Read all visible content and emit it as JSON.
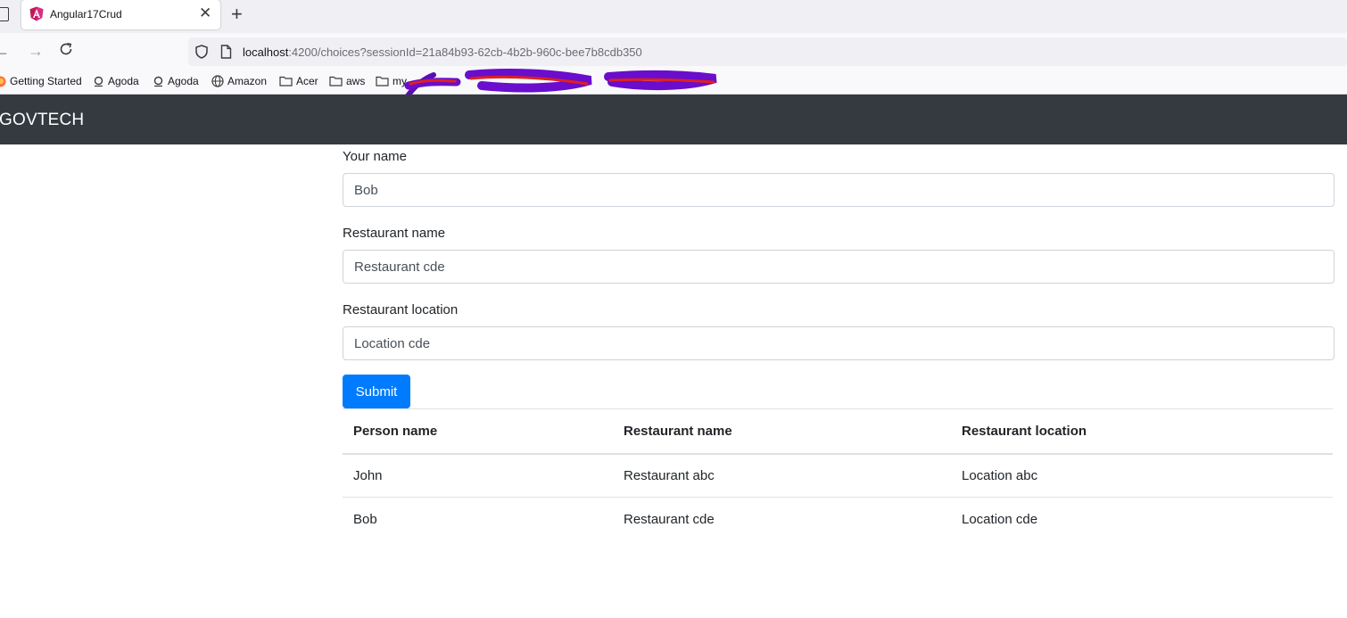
{
  "browser": {
    "tab": {
      "title": "Angular17Crud",
      "close_icon": "close-icon"
    },
    "new_tab_icon": "plus-icon",
    "url": {
      "host": "localhost",
      "rest": ":4200/choices?sessionId=21a84b93-62cb-4b2b-960c-bee7b8cdb350"
    },
    "bookmarks": [
      {
        "label": "Getting Started",
        "icon": "firefox-icon"
      },
      {
        "label": "Agoda",
        "icon": "agoda-icon"
      },
      {
        "label": "Agoda",
        "icon": "agoda-icon"
      },
      {
        "label": "Amazon",
        "icon": "globe-icon"
      },
      {
        "label": "Acer",
        "icon": "folder-icon"
      },
      {
        "label": "aws",
        "icon": "folder-icon"
      },
      {
        "label": "my",
        "icon": "folder-icon"
      }
    ]
  },
  "app": {
    "brand": "GOVTECH",
    "form": {
      "name_label": "Your name",
      "name_value": "Bob",
      "restaurant_label": "Restaurant name",
      "restaurant_value": "Restaurant cde",
      "location_label": "Restaurant location",
      "location_value": "Location cde",
      "submit_label": "Submit"
    },
    "table": {
      "headers": [
        "Person name",
        "Restaurant name",
        "Restaurant location"
      ],
      "rows": [
        [
          "John",
          "Restaurant abc",
          "Location abc"
        ],
        [
          "Bob",
          "Restaurant cde",
          "Location cde"
        ]
      ]
    }
  },
  "colors": {
    "navbar": "#343a40",
    "primary": "#007bff",
    "scribble_purple": "#6a0dcc",
    "scribble_red": "#e0201e"
  }
}
